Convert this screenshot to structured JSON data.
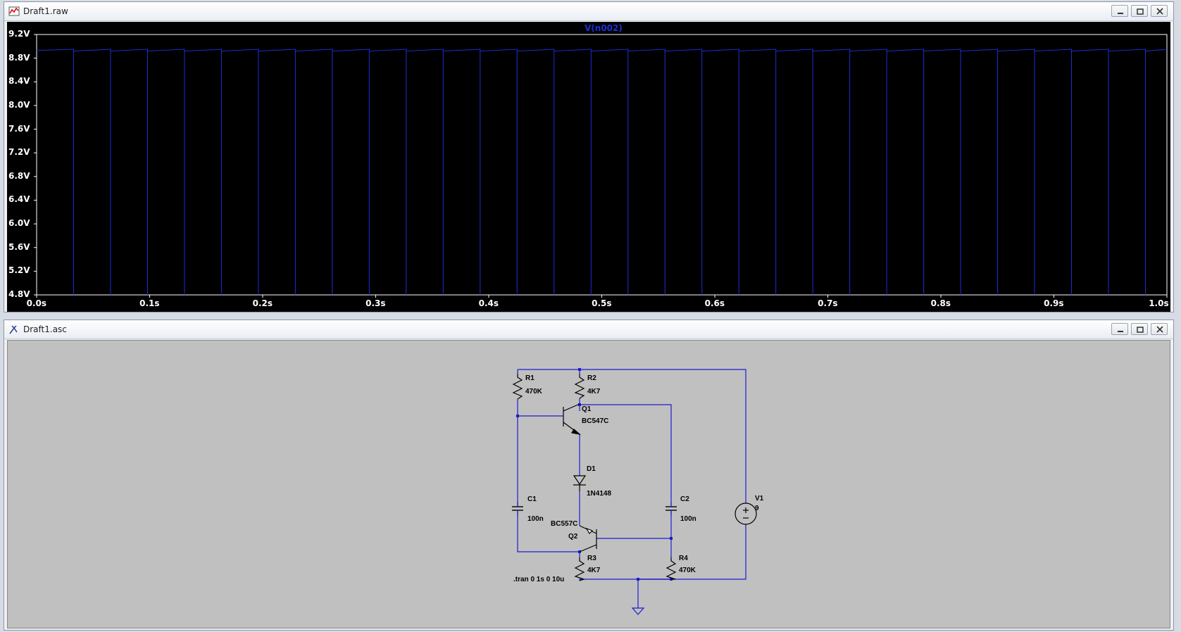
{
  "waveform_window": {
    "title": "Draft1.raw",
    "trace_label": "V(n002)",
    "trace_color": "#1c2fd6",
    "chart_data": {
      "type": "line",
      "title": "",
      "series": [
        {
          "name": "V(n002)",
          "pulse_period_s": 0.0327,
          "high_v": 8.95,
          "low_v": 4.8
        }
      ],
      "xlim": [
        0.0,
        1.0
      ],
      "ylim": [
        4.8,
        9.2
      ],
      "x_tick_labels": [
        "0.0s",
        "0.1s",
        "0.2s",
        "0.3s",
        "0.4s",
        "0.5s",
        "0.6s",
        "0.7s",
        "0.8s",
        "0.9s",
        "1.0s"
      ],
      "y_tick_labels": [
        "9.2V",
        "8.8V",
        "8.4V",
        "8.0V",
        "7.6V",
        "7.2V",
        "6.8V",
        "6.4V",
        "6.0V",
        "5.6V",
        "5.2V",
        "4.8V"
      ],
      "grid": false,
      "background": "#000000"
    }
  },
  "schematic_window": {
    "title": "Draft1.asc",
    "components": {
      "R1": {
        "name": "R1",
        "value": "470K"
      },
      "R2": {
        "name": "R2",
        "value": "4K7"
      },
      "Q1": {
        "name": "Q1",
        "value": "BC547C"
      },
      "D1": {
        "name": "D1",
        "value": "1N4148"
      },
      "C1": {
        "name": "C1",
        "value": "100n"
      },
      "C2": {
        "name": "C2",
        "value": "100n"
      },
      "Q2": {
        "name": "Q2",
        "value": "BC557C"
      },
      "R3": {
        "name": "R3",
        "value": "4K7"
      },
      "R4": {
        "name": "R4",
        "value": "470K"
      },
      "V1": {
        "name": "V1",
        "value": "9"
      }
    },
    "directive": ".tran 0 1s 0 10u",
    "wire_color": "#1c1ccf"
  }
}
